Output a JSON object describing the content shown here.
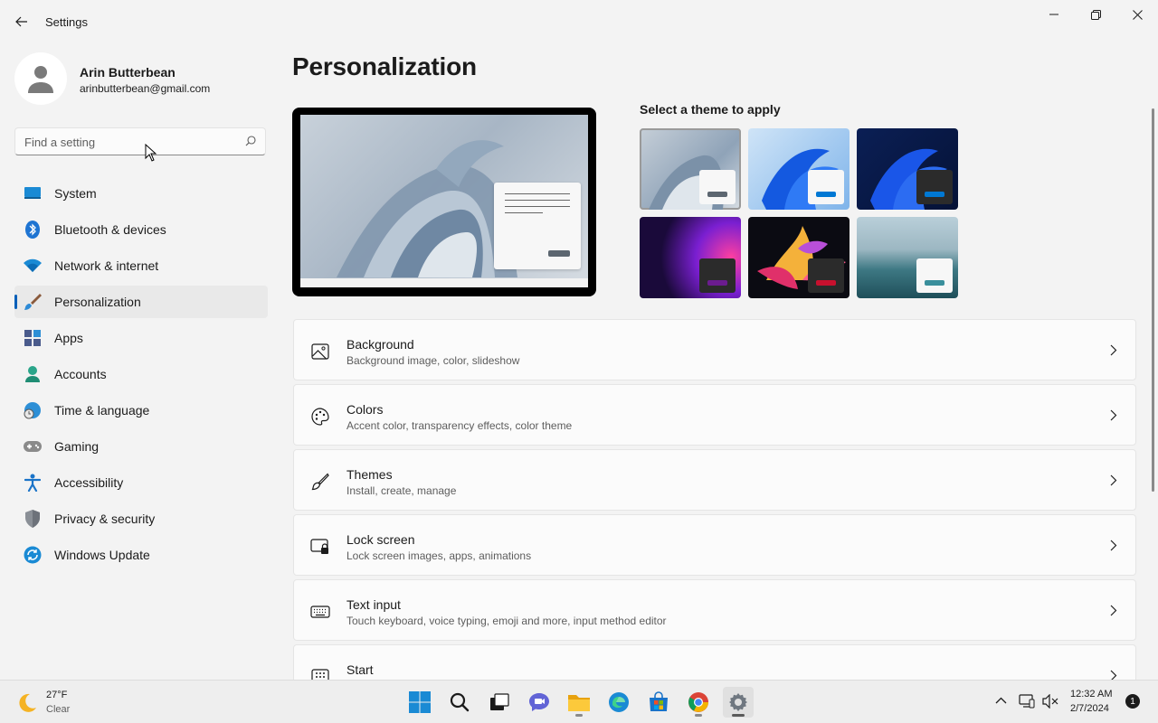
{
  "window": {
    "title": "Settings"
  },
  "profile": {
    "name": "Arin Butterbean",
    "email": "arinbutterbean@gmail.com"
  },
  "search": {
    "placeholder": "Find a setting"
  },
  "nav": {
    "items": [
      {
        "label": "System",
        "icon": "system-icon"
      },
      {
        "label": "Bluetooth & devices",
        "icon": "bluetooth-icon"
      },
      {
        "label": "Network & internet",
        "icon": "wifi-icon"
      },
      {
        "label": "Personalization",
        "icon": "paintbrush-icon",
        "selected": true
      },
      {
        "label": "Apps",
        "icon": "apps-icon"
      },
      {
        "label": "Accounts",
        "icon": "accounts-icon"
      },
      {
        "label": "Time & language",
        "icon": "globe-clock-icon"
      },
      {
        "label": "Gaming",
        "icon": "gamepad-icon"
      },
      {
        "label": "Accessibility",
        "icon": "accessibility-icon"
      },
      {
        "label": "Privacy & security",
        "icon": "shield-icon"
      },
      {
        "label": "Windows Update",
        "icon": "update-icon"
      }
    ]
  },
  "main": {
    "title": "Personalization",
    "theme_heading": "Select a theme to apply",
    "themes": [
      {
        "name": "windows-light",
        "accent": "#5c6670",
        "selected": true
      },
      {
        "name": "windows-bloom-light",
        "accent": "#0078d4"
      },
      {
        "name": "windows-bloom-dark",
        "accent": "#0078d4"
      },
      {
        "name": "glow",
        "accent": "#6b1c8f"
      },
      {
        "name": "captured-motion",
        "accent": "#c8102e"
      },
      {
        "name": "flow",
        "accent": "#3a8f9c"
      }
    ],
    "cards": [
      {
        "title": "Background",
        "subtitle": "Background image, color, slideshow",
        "icon": "image-icon"
      },
      {
        "title": "Colors",
        "subtitle": "Accent color, transparency effects, color theme",
        "icon": "palette-icon"
      },
      {
        "title": "Themes",
        "subtitle": "Install, create, manage",
        "icon": "brush-icon"
      },
      {
        "title": "Lock screen",
        "subtitle": "Lock screen images, apps, animations",
        "icon": "lock-screen-icon"
      },
      {
        "title": "Text input",
        "subtitle": "Touch keyboard, voice typing, emoji and more, input method editor",
        "icon": "keyboard-icon"
      },
      {
        "title": "Start",
        "subtitle": "",
        "icon": "start-icon"
      }
    ]
  },
  "taskbar": {
    "weather": {
      "temp": "27°F",
      "condition": "Clear"
    },
    "clock": {
      "time": "12:32 AM",
      "date": "2/7/2024"
    },
    "notifications": "1"
  },
  "colors": {
    "accent": "#005fb8",
    "background": "#f3f3f3",
    "card": "#fbfbfb"
  }
}
